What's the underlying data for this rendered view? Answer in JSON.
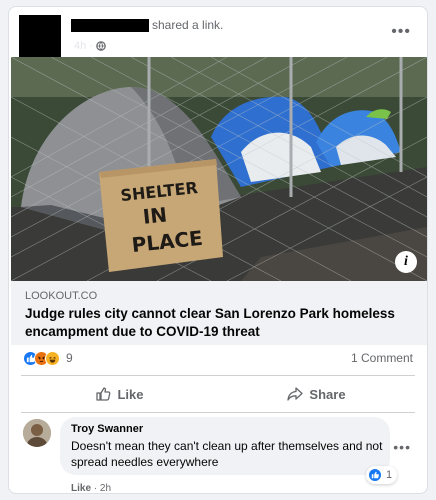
{
  "post": {
    "action_text": "shared a link.",
    "time": "4h",
    "time_separator": "·",
    "more_icon": "ellipsis-icon",
    "privacy_icon": "globe-icon"
  },
  "link": {
    "domain": "LOOKOUT.CO",
    "title": "Judge rules city cannot clear San Lorenzo Park homeless encampment due to COVID-19 threat",
    "info_label": "i",
    "image_sign_lines": [
      "SHELTER",
      "IN",
      "PLACE"
    ]
  },
  "stats": {
    "reactions": [
      "like",
      "angry",
      "haha"
    ],
    "reaction_count": "9",
    "comments": "1 Comment"
  },
  "actions": {
    "like": "Like",
    "share": "Share"
  },
  "comment": {
    "author": "Troy Swanner",
    "text": "Doesn't mean they can't clean up after themselves and not spread needles everywhere",
    "like_label": "Like",
    "separator": "·",
    "time": "2h",
    "reaction_count": "1"
  },
  "colors": {
    "brand": "#1877f2",
    "secondary_text": "#65676b",
    "link_bg": "#f0f2f5"
  }
}
